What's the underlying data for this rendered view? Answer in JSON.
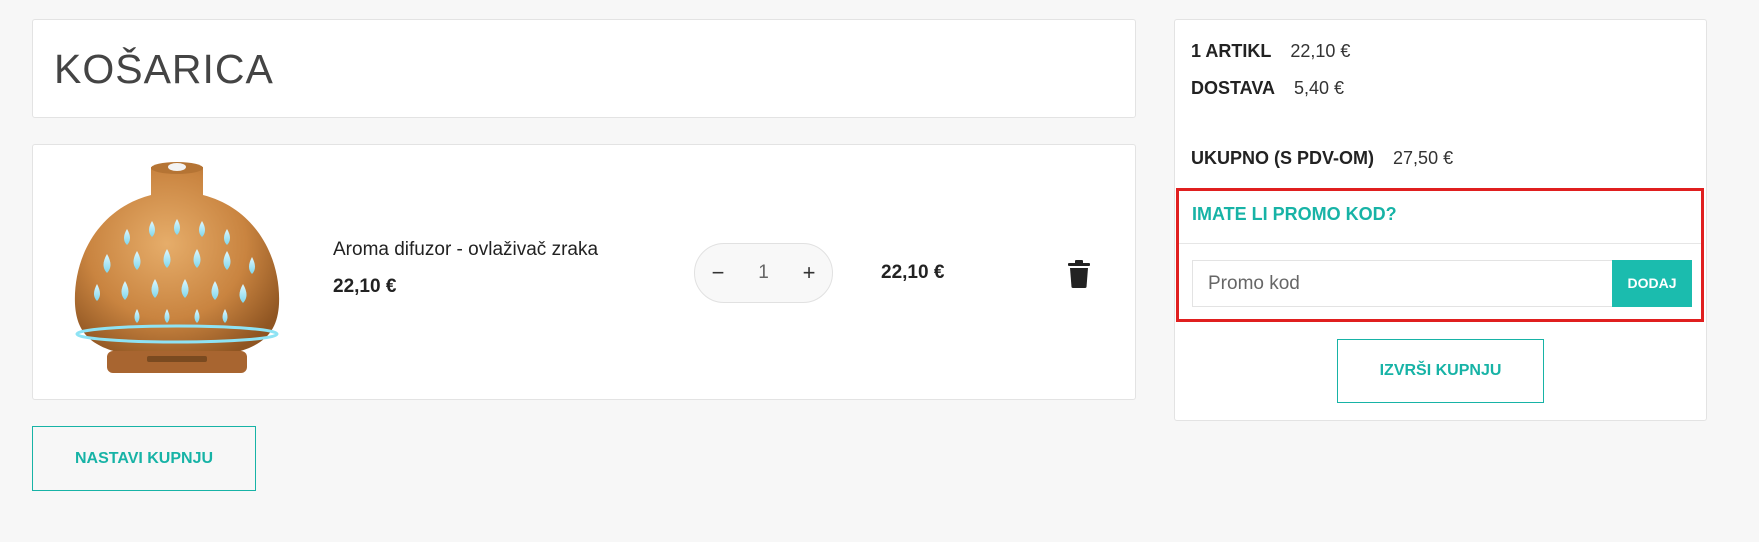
{
  "page": {
    "title": "KOŠARICA"
  },
  "cart": {
    "items": [
      {
        "name": "Aroma difuzor - ovlaživač zraka",
        "price": "22,10 €",
        "quantity": "1",
        "line_total": "22,10 €",
        "image_icon": "aroma-diffuser-image"
      }
    ],
    "continue_label": "NASTAVI KUPNJU",
    "qty_minus": "−",
    "qty_plus": "+"
  },
  "summary": {
    "items_label": "1 ARTIKL",
    "items_value": "22,10 €",
    "delivery_label": "DOSTAVA",
    "delivery_value": "5,40 €",
    "total_label": "UKUPNO (S PDV-OM)",
    "total_value": "27,50 €",
    "promo_title": "IMATE LI PROMO KOD?",
    "promo_placeholder": "Promo kod",
    "promo_button": "DODAJ",
    "checkout_label": "IZVRŠI KUPNJU"
  },
  "colors": {
    "accent": "#17b3a6",
    "highlight_border": "#e01f1f",
    "background": "#f7f7f7"
  }
}
